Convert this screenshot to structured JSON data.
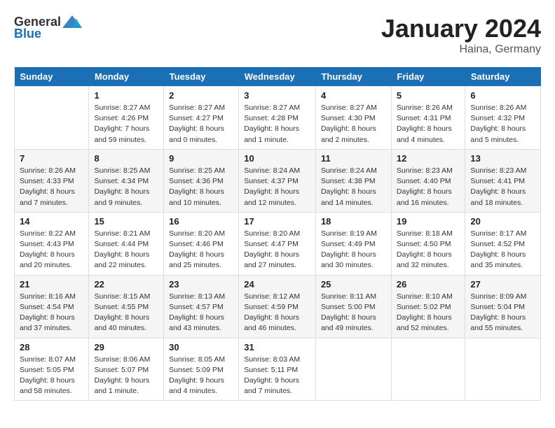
{
  "logo": {
    "general": "General",
    "blue": "Blue"
  },
  "title": "January 2024",
  "location": "Haina, Germany",
  "days_of_week": [
    "Sunday",
    "Monday",
    "Tuesday",
    "Wednesday",
    "Thursday",
    "Friday",
    "Saturday"
  ],
  "weeks": [
    [
      {
        "day": "",
        "info": ""
      },
      {
        "day": "1",
        "info": "Sunrise: 8:27 AM\nSunset: 4:26 PM\nDaylight: 7 hours\nand 59 minutes."
      },
      {
        "day": "2",
        "info": "Sunrise: 8:27 AM\nSunset: 4:27 PM\nDaylight: 8 hours\nand 0 minutes."
      },
      {
        "day": "3",
        "info": "Sunrise: 8:27 AM\nSunset: 4:28 PM\nDaylight: 8 hours\nand 1 minute."
      },
      {
        "day": "4",
        "info": "Sunrise: 8:27 AM\nSunset: 4:30 PM\nDaylight: 8 hours\nand 2 minutes."
      },
      {
        "day": "5",
        "info": "Sunrise: 8:26 AM\nSunset: 4:31 PM\nDaylight: 8 hours\nand 4 minutes."
      },
      {
        "day": "6",
        "info": "Sunrise: 8:26 AM\nSunset: 4:32 PM\nDaylight: 8 hours\nand 5 minutes."
      }
    ],
    [
      {
        "day": "7",
        "info": "Sunrise: 8:26 AM\nSunset: 4:33 PM\nDaylight: 8 hours\nand 7 minutes."
      },
      {
        "day": "8",
        "info": "Sunrise: 8:25 AM\nSunset: 4:34 PM\nDaylight: 8 hours\nand 9 minutes."
      },
      {
        "day": "9",
        "info": "Sunrise: 8:25 AM\nSunset: 4:36 PM\nDaylight: 8 hours\nand 10 minutes."
      },
      {
        "day": "10",
        "info": "Sunrise: 8:24 AM\nSunset: 4:37 PM\nDaylight: 8 hours\nand 12 minutes."
      },
      {
        "day": "11",
        "info": "Sunrise: 8:24 AM\nSunset: 4:38 PM\nDaylight: 8 hours\nand 14 minutes."
      },
      {
        "day": "12",
        "info": "Sunrise: 8:23 AM\nSunset: 4:40 PM\nDaylight: 8 hours\nand 16 minutes."
      },
      {
        "day": "13",
        "info": "Sunrise: 8:23 AM\nSunset: 4:41 PM\nDaylight: 8 hours\nand 18 minutes."
      }
    ],
    [
      {
        "day": "14",
        "info": "Sunrise: 8:22 AM\nSunset: 4:43 PM\nDaylight: 8 hours\nand 20 minutes."
      },
      {
        "day": "15",
        "info": "Sunrise: 8:21 AM\nSunset: 4:44 PM\nDaylight: 8 hours\nand 22 minutes."
      },
      {
        "day": "16",
        "info": "Sunrise: 8:20 AM\nSunset: 4:46 PM\nDaylight: 8 hours\nand 25 minutes."
      },
      {
        "day": "17",
        "info": "Sunrise: 8:20 AM\nSunset: 4:47 PM\nDaylight: 8 hours\nand 27 minutes."
      },
      {
        "day": "18",
        "info": "Sunrise: 8:19 AM\nSunset: 4:49 PM\nDaylight: 8 hours\nand 30 minutes."
      },
      {
        "day": "19",
        "info": "Sunrise: 8:18 AM\nSunset: 4:50 PM\nDaylight: 8 hours\nand 32 minutes."
      },
      {
        "day": "20",
        "info": "Sunrise: 8:17 AM\nSunset: 4:52 PM\nDaylight: 8 hours\nand 35 minutes."
      }
    ],
    [
      {
        "day": "21",
        "info": "Sunrise: 8:16 AM\nSunset: 4:54 PM\nDaylight: 8 hours\nand 37 minutes."
      },
      {
        "day": "22",
        "info": "Sunrise: 8:15 AM\nSunset: 4:55 PM\nDaylight: 8 hours\nand 40 minutes."
      },
      {
        "day": "23",
        "info": "Sunrise: 8:13 AM\nSunset: 4:57 PM\nDaylight: 8 hours\nand 43 minutes."
      },
      {
        "day": "24",
        "info": "Sunrise: 8:12 AM\nSunset: 4:59 PM\nDaylight: 8 hours\nand 46 minutes."
      },
      {
        "day": "25",
        "info": "Sunrise: 8:11 AM\nSunset: 5:00 PM\nDaylight: 8 hours\nand 49 minutes."
      },
      {
        "day": "26",
        "info": "Sunrise: 8:10 AM\nSunset: 5:02 PM\nDaylight: 8 hours\nand 52 minutes."
      },
      {
        "day": "27",
        "info": "Sunrise: 8:09 AM\nSunset: 5:04 PM\nDaylight: 8 hours\nand 55 minutes."
      }
    ],
    [
      {
        "day": "28",
        "info": "Sunrise: 8:07 AM\nSunset: 5:05 PM\nDaylight: 8 hours\nand 58 minutes."
      },
      {
        "day": "29",
        "info": "Sunrise: 8:06 AM\nSunset: 5:07 PM\nDaylight: 9 hours\nand 1 minute."
      },
      {
        "day": "30",
        "info": "Sunrise: 8:05 AM\nSunset: 5:09 PM\nDaylight: 9 hours\nand 4 minutes."
      },
      {
        "day": "31",
        "info": "Sunrise: 8:03 AM\nSunset: 5:11 PM\nDaylight: 9 hours\nand 7 minutes."
      },
      {
        "day": "",
        "info": ""
      },
      {
        "day": "",
        "info": ""
      },
      {
        "day": "",
        "info": ""
      }
    ]
  ]
}
